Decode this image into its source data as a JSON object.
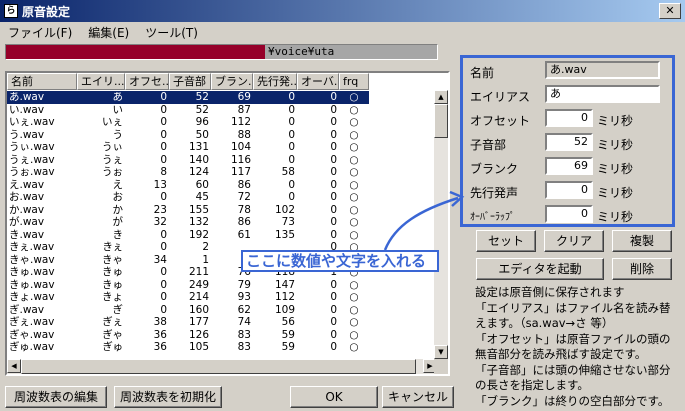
{
  "window": {
    "title": "原音設定"
  },
  "menu": [
    "ファイル(F)",
    "編集(E)",
    "ツール(T)"
  ],
  "path": {
    "text": "¥voice¥uta"
  },
  "columns": [
    "名前",
    "エイリ...",
    "オフセ...",
    "子音部",
    "ブラン...",
    "先行発...",
    "オーバ...",
    "frq"
  ],
  "rows": [
    [
      "あ.wav",
      "あ",
      "0",
      "52",
      "69",
      "0",
      "0",
      "○"
    ],
    [
      "い.wav",
      "い",
      "0",
      "52",
      "87",
      "0",
      "0",
      "○"
    ],
    [
      "いぇ.wav",
      "いぇ",
      "0",
      "96",
      "112",
      "0",
      "0",
      "○"
    ],
    [
      "う.wav",
      "う",
      "0",
      "50",
      "88",
      "0",
      "0",
      "○"
    ],
    [
      "うぃ.wav",
      "うぃ",
      "0",
      "131",
      "104",
      "0",
      "0",
      "○"
    ],
    [
      "うぇ.wav",
      "うぇ",
      "0",
      "140",
      "116",
      "0",
      "0",
      "○"
    ],
    [
      "うぉ.wav",
      "うぉ",
      "8",
      "124",
      "117",
      "58",
      "0",
      "○"
    ],
    [
      "え.wav",
      "え",
      "13",
      "60",
      "86",
      "0",
      "0",
      "○"
    ],
    [
      "お.wav",
      "お",
      "0",
      "45",
      "72",
      "0",
      "0",
      "○"
    ],
    [
      "か.wav",
      "か",
      "23",
      "155",
      "78",
      "102",
      "0",
      "○"
    ],
    [
      "が.wav",
      "が",
      "32",
      "132",
      "86",
      "73",
      "0",
      "○"
    ],
    [
      "き.wav",
      "き",
      "0",
      "192",
      "61",
      "135",
      "0",
      "○"
    ],
    [
      "きぇ.wav",
      "きぇ",
      "0",
      "2",
      "",
      "",
      "0",
      "○"
    ],
    [
      "きゃ.wav",
      "きゃ",
      "34",
      "1",
      "",
      "",
      "0",
      "○"
    ],
    [
      "きゅ.wav",
      "きゅ",
      "0",
      "211",
      "76",
      "118",
      "1",
      "○"
    ],
    [
      "きゅ.wav",
      "きゅ",
      "0",
      "249",
      "79",
      "147",
      "0",
      "○"
    ],
    [
      "きょ.wav",
      "きょ",
      "0",
      "214",
      "93",
      "112",
      "0",
      "○"
    ],
    [
      "ぎ.wav",
      "ぎ",
      "0",
      "160",
      "62",
      "109",
      "0",
      "○"
    ],
    [
      "ぎぇ.wav",
      "ぎぇ",
      "38",
      "177",
      "74",
      "56",
      "0",
      "○"
    ],
    [
      "ぎゃ.wav",
      "ぎゃ",
      "36",
      "126",
      "83",
      "59",
      "0",
      "○"
    ],
    [
      "ぎゅ.wav",
      "ぎゅ",
      "36",
      "105",
      "83",
      "59",
      "0",
      "○"
    ]
  ],
  "panel": {
    "name_label": "名前",
    "name_value": "あ.wav",
    "alias_label": "エイリアス",
    "alias_value": "あ",
    "offset_label": "オフセット",
    "offset_value": "0",
    "consonant_label": "子音部",
    "consonant_value": "52",
    "blank_label": "ブランク",
    "blank_value": "69",
    "preutter_label": "先行発声",
    "preutter_value": "0",
    "overlap_label": "ｵｰﾊﾞｰﾗｯﾌﾟ",
    "overlap_value": "0",
    "unit": "ミリ秒"
  },
  "buttons": {
    "set": "セット",
    "clear": "クリア",
    "duplicate": "複製",
    "launch_editor": "エディタを起動",
    "delete": "削除",
    "edit_freq": "周波数表の編集",
    "init_freq": "周波数表を初期化",
    "ok": "OK",
    "cancel": "キャンセル"
  },
  "info": [
    "設定は原音側に保存されます",
    "「エイリアス」はファイル名を読み替えます。（sa.wav→さ 等）",
    "「オフセット」は原音ファイルの頭の無音部分を読み飛ばす設定です。",
    "「子音部」には頭の伸縮させない部分の長さを指定します。",
    "「ブランク」は終りの空白部分です。"
  ],
  "annotation": {
    "text": "ここに数値や文字を入れる",
    "color": "#3a66d4"
  }
}
